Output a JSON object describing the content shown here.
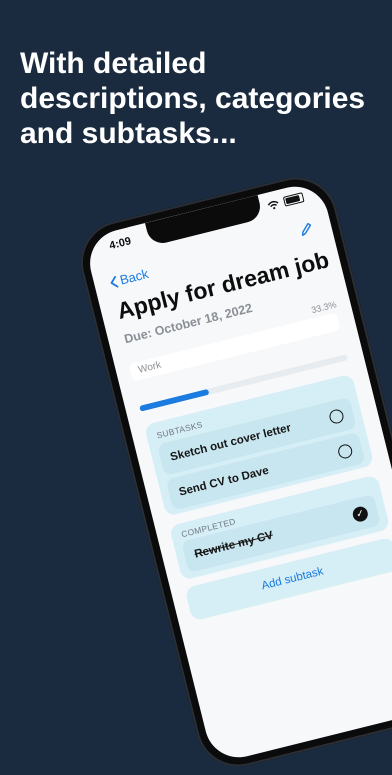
{
  "headline": {
    "line1": "With detailed",
    "line2": "descriptions, categories",
    "line3": "and subtasks..."
  },
  "status_bar": {
    "time": "4:09"
  },
  "nav": {
    "back_label": "Back",
    "edit_icon": "pencil-icon"
  },
  "task": {
    "title": "Apply for dream job",
    "due": "Due: October 18, 2022",
    "category": "Work",
    "progress_label": "33.3%",
    "progress_fraction": 0.333
  },
  "subtasks": {
    "header": "SUBTASKS",
    "items": [
      {
        "label": "Sketch out cover letter",
        "done": false
      },
      {
        "label": "Send CV to Dave",
        "done": false
      }
    ]
  },
  "completed": {
    "header": "COMPLETED",
    "items": [
      {
        "label": "Rewrite my CV",
        "done": true
      }
    ]
  },
  "add_subtask_label": "Add subtask",
  "colors": {
    "background": "#1a2b3f",
    "accent": "#1a7be0",
    "card": "#d6eef5"
  }
}
